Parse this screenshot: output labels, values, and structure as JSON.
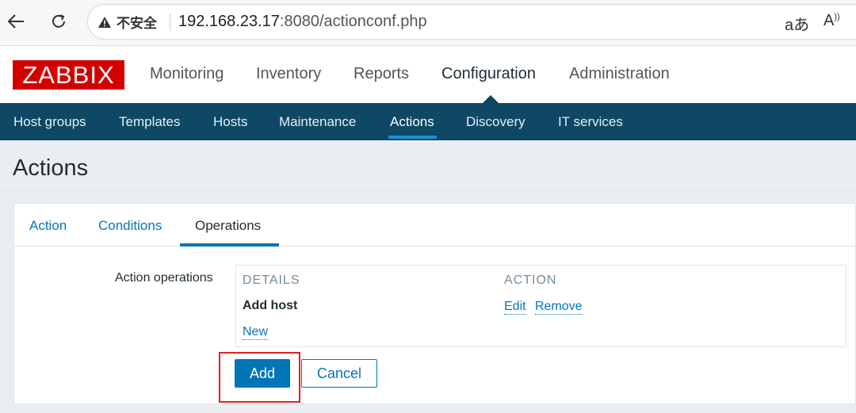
{
  "browser": {
    "security_label": "不安全",
    "url_host": "192.168.23.17",
    "url_rest": ":8080/actionconf.php"
  },
  "header": {
    "logo": "ZABBIX",
    "menu": [
      "Monitoring",
      "Inventory",
      "Reports",
      "Configuration",
      "Administration"
    ],
    "active_menu": "Configuration"
  },
  "subnav": {
    "items": [
      "Host groups",
      "Templates",
      "Hosts",
      "Maintenance",
      "Actions",
      "Discovery",
      "IT services"
    ],
    "active": "Actions"
  },
  "page": {
    "title": "Actions"
  },
  "tabs": {
    "items": [
      "Action",
      "Conditions",
      "Operations"
    ],
    "active": "Operations"
  },
  "form": {
    "label": "Action operations",
    "columns": [
      "DETAILS",
      "ACTION"
    ],
    "operations": [
      {
        "details": "Add host",
        "actions": [
          "Edit",
          "Remove"
        ]
      }
    ],
    "new_link": "New"
  },
  "buttons": {
    "add": "Add",
    "cancel": "Cancel"
  },
  "colors": {
    "brand": "#d40000",
    "subnav_bg": "#0e4865",
    "link": "#0275b8",
    "highlight": "#e02020"
  }
}
